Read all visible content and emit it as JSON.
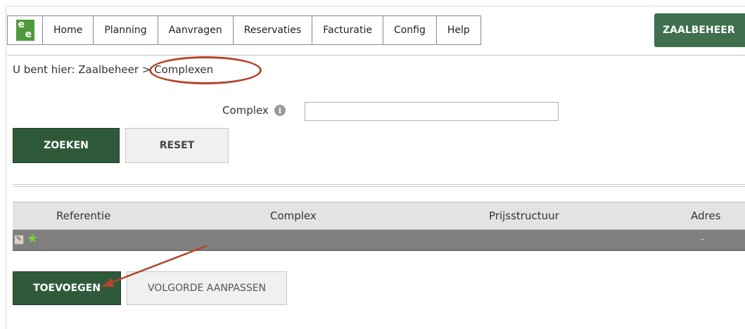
{
  "nav": {
    "items": [
      "Home",
      "Planning",
      "Aanvragen",
      "Reservaties",
      "Facturatie",
      "Config",
      "Help"
    ],
    "brand_button": "ZAALBEHEER"
  },
  "breadcrumb": "U bent hier: Zaalbeheer > Complexen",
  "search": {
    "label": "Complex",
    "value": "",
    "search_button": "ZOEKEN",
    "reset_button": "RESET"
  },
  "table": {
    "columns": [
      "Referentie",
      "Complex",
      "Prijsstructuur",
      "Adres"
    ],
    "rows": [
      {
        "referentie": "",
        "complex": "",
        "prijsstructuur": "",
        "adres": "-"
      }
    ]
  },
  "actions": {
    "add_button": "TOEVOEGEN",
    "reorder_button": "VOLGORDE AANPASSEN"
  },
  "colors": {
    "primary_green": "#2f5a3a",
    "annotation_red": "#b5432a",
    "header_gray": "#e3e3e3",
    "row_gray": "#7f7f7f"
  }
}
